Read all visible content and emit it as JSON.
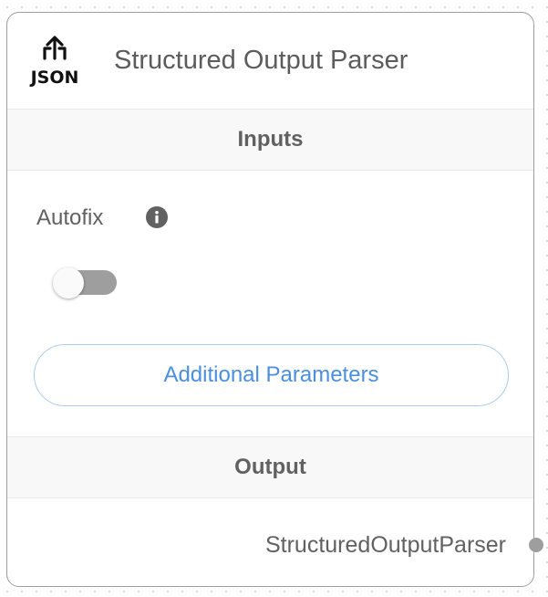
{
  "node": {
    "icon": "json-upload-icon",
    "icon_text": "JSON",
    "title": "Structured Output Parser"
  },
  "inputs": {
    "section_label": "Inputs",
    "params": [
      {
        "label": "Autofix",
        "info_icon": "info-icon",
        "control": "toggle",
        "checked": false
      }
    ],
    "additional_button_label": "Additional Parameters"
  },
  "output": {
    "section_label": "Output",
    "label": "StructuredOutputParser",
    "handle_color": "#9e9e9e"
  },
  "colors": {
    "accent": "#4a8fe0",
    "border": "#9e9e9e",
    "section_bg": "#f8f8f8"
  }
}
